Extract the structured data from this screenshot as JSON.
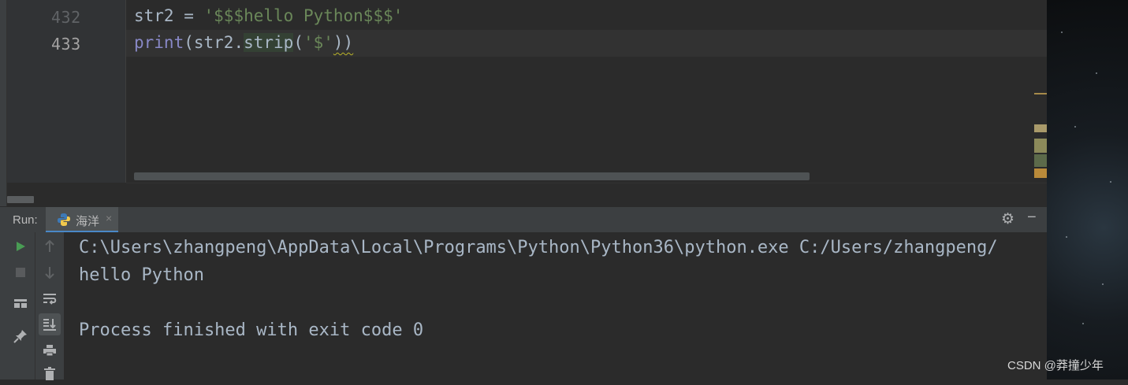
{
  "editor": {
    "lines": [
      {
        "number": "432",
        "segments": {
          "var": "str2",
          "op": " = ",
          "str": "'$$$hello Python$$$'"
        }
      },
      {
        "number": "433",
        "segments": {
          "fn": "print",
          "open": "(",
          "obj": "str2.",
          "method": "strip",
          "args_open": "(",
          "arg": "'$'",
          "close": "))"
        }
      }
    ]
  },
  "run_panel": {
    "label": "Run:",
    "tab_name": "海洋",
    "close_glyph": "×",
    "settings_icon": "gear-icon",
    "minimize_icon": "minus-icon",
    "console_lines": [
      "C:\\Users\\zhangpeng\\AppData\\Local\\Programs\\Python\\Python36\\python.exe C:/Users/zhangpeng/",
      "hello Python",
      "",
      "Process finished with exit code 0"
    ]
  },
  "watermark": "CSDN @莽撞少年",
  "colors": {
    "editor_bg": "#2b2b2b",
    "panel_bg": "#3c3f41",
    "code_text": "#a9b7c6",
    "string": "#6a8759",
    "builtin": "#8888c6",
    "run_green": "#499c54",
    "tab_underline": "#4a88c7"
  }
}
